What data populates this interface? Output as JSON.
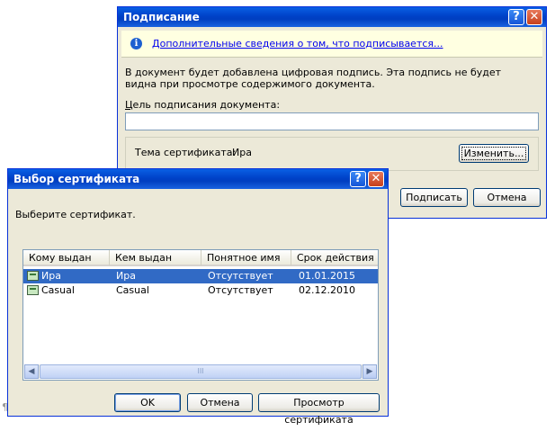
{
  "sign_dialog": {
    "title": "Подписание",
    "info_link": "Дополнительные сведения о том, что подписывается...",
    "description": "В документ будет добавлена цифровая подпись. Эта подпись не будет видна при просмотре содержимого документа.",
    "purpose_label": "Цель подписания документа:",
    "purpose_value": "",
    "cert_subject_label": "Тема сертификата:",
    "cert_subject_value": "Ира",
    "change_button": "Изменить...",
    "sign_button": "Подписать",
    "cancel_button": "Отмена",
    "help_glyph": "?",
    "close_glyph": "✕"
  },
  "cert_dialog": {
    "title": "Выбор сертификата",
    "prompt": "Выберите сертификат.",
    "columns": [
      "Кому выдан",
      "Кем выдан",
      "Понятное имя",
      "Срок действия"
    ],
    "rows": [
      {
        "issued_to": "Ира",
        "issued_by": "Ира",
        "friendly_name": "Отсутствует",
        "expires": "01.01.2015",
        "selected": true
      },
      {
        "issued_to": "Casual",
        "issued_by": "Casual",
        "friendly_name": "Отсутствует",
        "expires": "02.12.2010",
        "selected": false
      }
    ],
    "ok_button": "OK",
    "cancel_button": "Отмена",
    "view_button": "Просмотр сертификата",
    "help_glyph": "?",
    "close_glyph": "✕",
    "scroll_left_glyph": "◀",
    "scroll_right_glyph": "▶",
    "thumb_glyph": "III"
  },
  "background_mark": "¶",
  "colors": {
    "title_blue": "#0042c8",
    "selection": "#316ac5",
    "info_bg": "#ffffe1"
  }
}
